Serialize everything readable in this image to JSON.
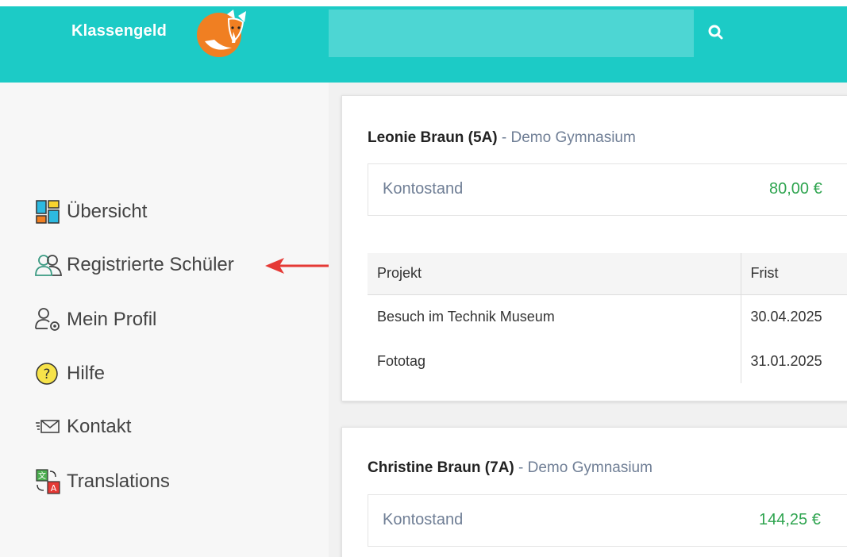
{
  "header": {
    "brand": "Klassengeld",
    "search_placeholder": "",
    "accent_color": "#1ccbc6"
  },
  "sidebar": {
    "items": [
      {
        "label": "Übersicht",
        "icon": "dashboard-icon"
      },
      {
        "label": "Registrierte Schüler",
        "icon": "users-icon"
      },
      {
        "label": "Mein Profil",
        "icon": "profile-settings-icon"
      },
      {
        "label": "Hilfe",
        "icon": "help-icon"
      },
      {
        "label": "Kontakt",
        "icon": "mail-icon"
      },
      {
        "label": "Translations",
        "icon": "translate-icon"
      }
    ]
  },
  "cards": [
    {
      "name": "Leonie Braun (5A)",
      "school": " - Demo Gymnasium",
      "balance_label": "Kontostand",
      "balance_value": "80,00 €",
      "table": {
        "headers": [
          "Projekt",
          "Frist"
        ],
        "rows": [
          [
            "Besuch im Technik Museum",
            "30.04.2025"
          ],
          [
            "Fototag",
            "31.01.2025"
          ]
        ]
      }
    },
    {
      "name": "Christine Braun (7A)",
      "school": " - Demo Gymnasium",
      "balance_label": "Kontostand",
      "balance_value": "144,25 €"
    }
  ]
}
